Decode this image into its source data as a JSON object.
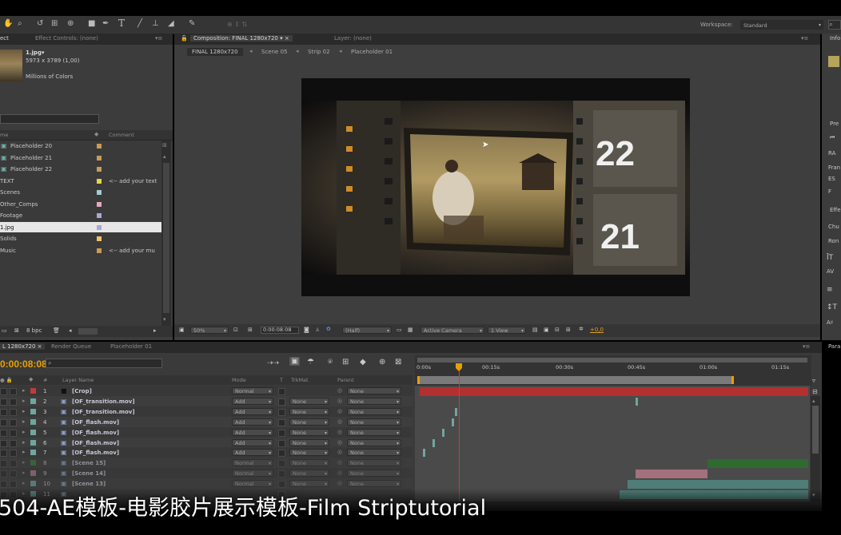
{
  "toolbar": {
    "workspace_label": "Workspace:",
    "workspace_value": "Standard",
    "tool_icons": [
      "hand-icon",
      "zoom-icon",
      "rotate-icon",
      "camera-orbit-icon",
      "pan-behind-icon",
      "rect-mask-icon",
      "pen-icon",
      "type-icon",
      "brush-icon",
      "clone-stamp-icon",
      "eraser-icon",
      "puppet-pin-icon"
    ]
  },
  "project_panel": {
    "tabs": [
      "ect",
      "Effect Controls: (none)"
    ],
    "asset_name": "1.jpg▾",
    "asset_dims": "5973 x 3789 (1,00)",
    "asset_colors": "Millions of Colors",
    "col_name": "me",
    "col_comment": "Comment",
    "items": [
      {
        "name": "Placeholder 20",
        "color": "#c99a5a",
        "comment": "",
        "icon": "composition-icon"
      },
      {
        "name": "Placeholder 21",
        "color": "#c99a5a",
        "comment": "",
        "icon": "composition-icon"
      },
      {
        "name": "Placeholder 22",
        "color": "#c99a5a",
        "comment": "",
        "icon": "composition-icon"
      },
      {
        "name": "TEXT",
        "color": "#e8d44a",
        "comment": "<-- add your text",
        "icon": ""
      },
      {
        "name": "Scenes",
        "color": "#9fd0d0",
        "comment": "",
        "icon": ""
      },
      {
        "name": "Other_Comps",
        "color": "#e6a7c0",
        "comment": "",
        "icon": ""
      },
      {
        "name": "Footage",
        "color": "#a9a9d6",
        "comment": "",
        "icon": ""
      },
      {
        "name": "1.jpg",
        "color": "#a9a9d6",
        "comment": "",
        "icon": "",
        "selected": true
      },
      {
        "name": "Solids",
        "color": "#f0c070",
        "comment": "",
        "icon": ""
      },
      {
        "name": "Music",
        "color": "#c99a5a",
        "comment": "<-- add your mu",
        "icon": ""
      }
    ],
    "bpc": "8 bpc"
  },
  "composition_panel": {
    "tab_active": "Composition: FINAL 1280x720",
    "tab_layer": "Layer: (none)",
    "breadcrumbs": [
      "FINAL 1280x720",
      "Scene 05",
      "Strip 02",
      "Placeholder 01"
    ],
    "frame_numbers": [
      "22",
      "21"
    ],
    "zoom": "50%",
    "timecode": "0:00:08:08",
    "resolution": "(Half)",
    "camera": "Active Camera",
    "views": "1 View",
    "exposure": "+0,0"
  },
  "right_panels": {
    "info_tab": "Info",
    "preview_tab": "Pre",
    "preview_rows": [
      "RA",
      "Fran",
      "ES",
      "F"
    ],
    "effects_tab": "Effe",
    "effects_rows": [
      "Chu",
      "Ron"
    ],
    "paragraph_tab": "Para"
  },
  "timeline": {
    "tabs": [
      "L 1280x720",
      "Render Queue",
      "Placeholder 01"
    ],
    "timecode": "0:00:08:08",
    "search_placeholder": "",
    "col_headers": {
      "num": "#",
      "layer_name": "Layer Name",
      "mode": "Mode",
      "t": "T",
      "trkmat": "TrkMat",
      "parent": "Parent"
    },
    "ruler": [
      "0:00s",
      "00:15s",
      "00:30s",
      "00:45s",
      "01:00s",
      "01:15s"
    ],
    "layers": [
      {
        "num": "1",
        "name": "[Crop]",
        "color": "#c23a3a",
        "mode": "Normal",
        "trkmat": "",
        "parent": "None",
        "icon": "solid-icon",
        "faded": false
      },
      {
        "num": "2",
        "name": "[OF_transition.mov]",
        "color": "#6fa6a0",
        "mode": "Add",
        "trkmat": "None",
        "parent": "None",
        "icon": "footage-icon",
        "faded": false
      },
      {
        "num": "3",
        "name": "[OF_transition.mov]",
        "color": "#6fa6a0",
        "mode": "Add",
        "trkmat": "None",
        "parent": "None",
        "icon": "footage-icon",
        "faded": false
      },
      {
        "num": "4",
        "name": "[OF_flash.mov]",
        "color": "#6fa6a0",
        "mode": "Add",
        "trkmat": "None",
        "parent": "None",
        "icon": "footage-icon",
        "faded": false
      },
      {
        "num": "5",
        "name": "[OF_flash.mov]",
        "color": "#6fa6a0",
        "mode": "Add",
        "trkmat": "None",
        "parent": "None",
        "icon": "footage-icon",
        "faded": false
      },
      {
        "num": "6",
        "name": "[OF_flash.mov]",
        "color": "#6fa6a0",
        "mode": "Add",
        "trkmat": "None",
        "parent": "None",
        "icon": "footage-icon",
        "faded": false
      },
      {
        "num": "7",
        "name": "[OF_flash.mov]",
        "color": "#6fa6a0",
        "mode": "Add",
        "trkmat": "None",
        "parent": "None",
        "icon": "footage-icon",
        "faded": false
      },
      {
        "num": "8",
        "name": "[Scene 15]",
        "color": "#3c7a3c",
        "mode": "Normal",
        "trkmat": "None",
        "parent": "None",
        "icon": "composition-icon",
        "faded": true
      },
      {
        "num": "9",
        "name": "[Scene 14]",
        "color": "#b07a8a",
        "mode": "Normal",
        "trkmat": "None",
        "parent": "None",
        "icon": "composition-icon",
        "faded": true
      },
      {
        "num": "10",
        "name": "[Scene 13]",
        "color": "#6fa6a0",
        "mode": "Normal",
        "trkmat": "None",
        "parent": "None",
        "icon": "composition-icon",
        "faded": true
      },
      {
        "num": "11",
        "name": "",
        "color": "#6fa6a0",
        "mode": "",
        "trkmat": "",
        "parent": "",
        "icon": "composition-icon",
        "faded": true
      }
    ]
  },
  "caption": "504-AE模板-电影胶片展示模板-Film Striptutorial",
  "colors": {
    "panel": "#3c3c3c",
    "accent_playhead": "#e8a000",
    "crop_bar": "#b23030"
  }
}
